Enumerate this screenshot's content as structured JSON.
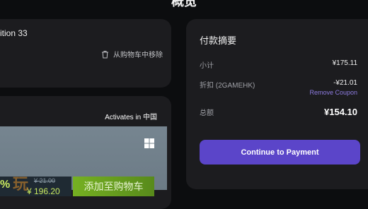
{
  "page": {
    "title": "概览"
  },
  "cart_item": {
    "name": "ition 33",
    "remove_label": "从购物车中移除",
    "remove_icon": "trash-icon"
  },
  "activation": {
    "activates_label": "Activates in 中国",
    "platform_icon": "windows-icon"
  },
  "store_overlay": {
    "discount_text": "%",
    "original_price": "¥ 21.00",
    "current_price": "¥ 196.20",
    "add_to_cart_label": "添加至购物车",
    "watermark": "玩"
  },
  "summary": {
    "title": "付款摘要",
    "subtotal_label": "小计",
    "subtotal_value": "¥175.11",
    "discount_label": "折扣 (2GAMEHK)",
    "discount_value": "-¥21.01",
    "remove_coupon_label": "Remove Coupon",
    "total_label": "总额",
    "total_value": "¥154.10",
    "pay_button_label": "Continue to Payment"
  },
  "colors": {
    "accent": "#5b45c9",
    "coupon_link": "#8d7be0",
    "store_green": "#75b022"
  }
}
